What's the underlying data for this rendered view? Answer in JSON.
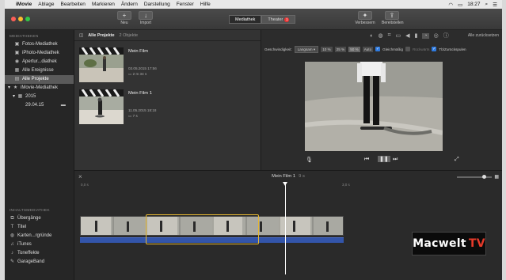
{
  "menubar": {
    "app_name": "iMovie",
    "items": [
      "Ablage",
      "Bearbeiten",
      "Markieren",
      "Ändern",
      "Darstellung",
      "Fenster",
      "Hilfe"
    ],
    "clock": "18:27"
  },
  "toolbar": {
    "new_label": "Neu",
    "import_label": "Import",
    "tab_mediathek": "Mediathek",
    "tab_theater": "Theater",
    "theater_badge": "1",
    "enhance_label": "Verbessern",
    "share_label": "Bereitstellen"
  },
  "sidebar": {
    "section_libraries": "MEDIATHEKEN",
    "libraries": [
      {
        "label": "Fotos-Mediathek",
        "icon": "photos-icon"
      },
      {
        "label": "iPhoto-Mediathek",
        "icon": "iphoto-icon"
      },
      {
        "label": "Apertur...diathek",
        "icon": "aperture-icon"
      },
      {
        "label": "Alle Ereignisse",
        "icon": "events-icon"
      },
      {
        "label": "Alle Projekte",
        "icon": "projects-icon"
      },
      {
        "label": "iMovie-Mediathek",
        "icon": "library-icon"
      },
      {
        "label": "2015",
        "icon": "year-icon"
      },
      {
        "label": "29.04.15",
        "icon": "event-icon"
      }
    ],
    "section_content": "INHALTSMEDIATHEK",
    "content": [
      {
        "label": "Übergänge"
      },
      {
        "label": "Titel"
      },
      {
        "label": "Karten...rgründe"
      },
      {
        "label": "iTunes"
      },
      {
        "label": "Toneffekte"
      },
      {
        "label": "GarageBand"
      }
    ]
  },
  "browser": {
    "title": "Alle Projekte",
    "count": "2 Objekte",
    "projects": [
      {
        "name": "Mein Film",
        "date": "03.05.2015 17:56",
        "duration": "2 m 34 s"
      },
      {
        "name": "Mein Film 1",
        "date": "11.05.2015 18:18",
        "duration": "7 s"
      }
    ]
  },
  "viewer": {
    "reset_label": "Alle zurücksetzen",
    "speed_label": "Geschwindigkeit:",
    "speed_value": "Langsam",
    "pct_10": "10 %",
    "pct_25": "25 %",
    "pct_50": "50 %",
    "auto_label": "Auto",
    "smooth_label": "Gleichmäßig",
    "reverse_label": "Rückwärts",
    "rewind_label": "Tb/Zurückspulen"
  },
  "timeline": {
    "title": "Mein Film 1",
    "duration": "9 s",
    "ruler_left": "0,0 s",
    "ruler_right": "3,0 s"
  },
  "watermark": {
    "word1": "Macwelt",
    "word2": "TV"
  }
}
